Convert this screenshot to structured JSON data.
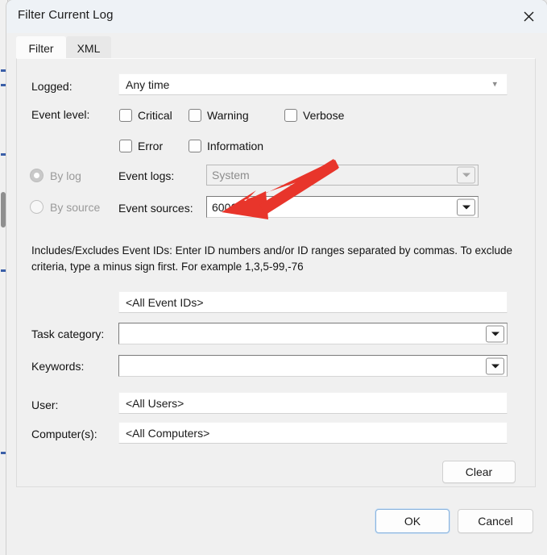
{
  "window": {
    "title": "Filter Current Log",
    "close_icon": "close-icon"
  },
  "tabs": [
    {
      "label": "Filter",
      "active": true
    },
    {
      "label": "XML",
      "active": false
    }
  ],
  "form": {
    "logged": {
      "label": "Logged:",
      "value": "Any time",
      "chevron": "chevron-down-icon"
    },
    "event_level": {
      "label": "Event level:",
      "options": [
        {
          "label": "Critical",
          "checked": false
        },
        {
          "label": "Warning",
          "checked": false
        },
        {
          "label": "Verbose",
          "checked": false
        },
        {
          "label": "Error",
          "checked": false
        },
        {
          "label": "Information",
          "checked": false
        }
      ]
    },
    "scope": {
      "by_log": {
        "label": "By log",
        "selected": true,
        "enabled": false
      },
      "by_source": {
        "label": "By source",
        "selected": false,
        "enabled": false
      }
    },
    "event_logs": {
      "label": "Event logs:",
      "value": "System",
      "enabled": false
    },
    "event_sources": {
      "label": "Event sources:",
      "value": "6006",
      "enabled": true
    },
    "event_ids": {
      "help": "Includes/Excludes Event IDs: Enter ID numbers and/or ID ranges separated by commas. To exclude criteria, type a minus sign first. For example 1,3,5-99,-76",
      "value": "<All Event IDs>"
    },
    "task_category": {
      "label": "Task category:",
      "value": ""
    },
    "keywords": {
      "label": "Keywords:",
      "value": ""
    },
    "user": {
      "label": "User:",
      "value": "<All Users>"
    },
    "computers": {
      "label": "Computer(s):",
      "value": "<All Computers>"
    }
  },
  "buttons": {
    "clear": "Clear",
    "ok": "OK",
    "cancel": "Cancel"
  },
  "annotation": {
    "arrow_color": "#e8352b",
    "points_to": "event-sources-input"
  }
}
